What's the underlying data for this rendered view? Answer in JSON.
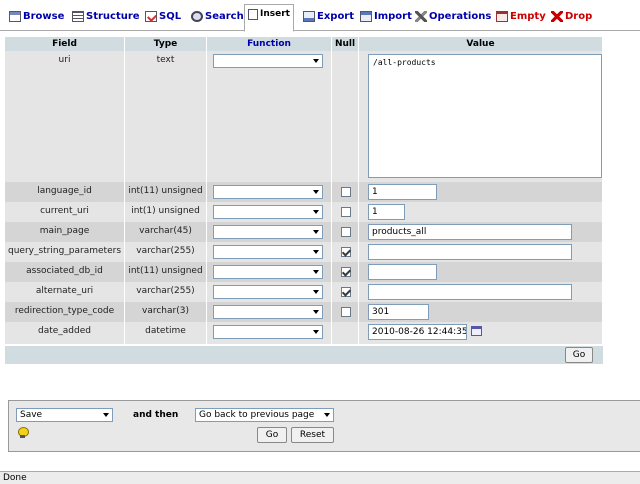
{
  "tabs": [
    {
      "label": "Browse",
      "icon": "browse-icon"
    },
    {
      "label": "Structure",
      "icon": "structure-icon"
    },
    {
      "label": "SQL",
      "icon": "sql-icon"
    },
    {
      "label": "Search",
      "icon": "search-icon"
    },
    {
      "label": "Insert",
      "icon": "insert-icon"
    },
    {
      "label": "Export",
      "icon": "export-icon"
    },
    {
      "label": "Import",
      "icon": "import-icon"
    },
    {
      "label": "Operations",
      "icon": "operations-icon"
    },
    {
      "label": "Empty",
      "icon": "empty-icon"
    },
    {
      "label": "Drop",
      "icon": "drop-icon"
    }
  ],
  "active_tab": "Insert",
  "table": {
    "headers": {
      "field": "Field",
      "type": "Type",
      "function": "Function",
      "null": "Null",
      "value": "Value"
    },
    "rows": [
      {
        "field": "uri",
        "type": "text",
        "function": "",
        "null_checked": false,
        "null_shown": false,
        "value": "/all-products"
      },
      {
        "field": "language_id",
        "type": "int(11) unsigned",
        "function": "",
        "null_checked": false,
        "null_shown": true,
        "value": "1"
      },
      {
        "field": "current_uri",
        "type": "int(1) unsigned",
        "function": "",
        "null_checked": false,
        "null_shown": true,
        "value": "1"
      },
      {
        "field": "main_page",
        "type": "varchar(45)",
        "function": "",
        "null_checked": false,
        "null_shown": true,
        "value": "products_all"
      },
      {
        "field": "query_string_parameters",
        "type": "varchar(255)",
        "function": "",
        "null_checked": true,
        "null_shown": true,
        "value": ""
      },
      {
        "field": "associated_db_id",
        "type": "int(11) unsigned",
        "function": "",
        "null_checked": true,
        "null_shown": true,
        "value": ""
      },
      {
        "field": "alternate_uri",
        "type": "varchar(255)",
        "function": "",
        "null_checked": true,
        "null_shown": true,
        "value": ""
      },
      {
        "field": "redirection_type_code",
        "type": "varchar(3)",
        "function": "",
        "null_checked": false,
        "null_shown": true,
        "value": "301"
      },
      {
        "field": "date_added",
        "type": "datetime",
        "function": "",
        "null_checked": false,
        "null_shown": false,
        "value": "2010-08-26 12:44:35"
      }
    ],
    "go_label": "Go"
  },
  "bottom": {
    "action_select": "Save",
    "and_then_label": "and then",
    "after_select": "Go back to previous page",
    "go_label": "Go",
    "reset_label": "Reset"
  },
  "status": {
    "text": "Done"
  }
}
